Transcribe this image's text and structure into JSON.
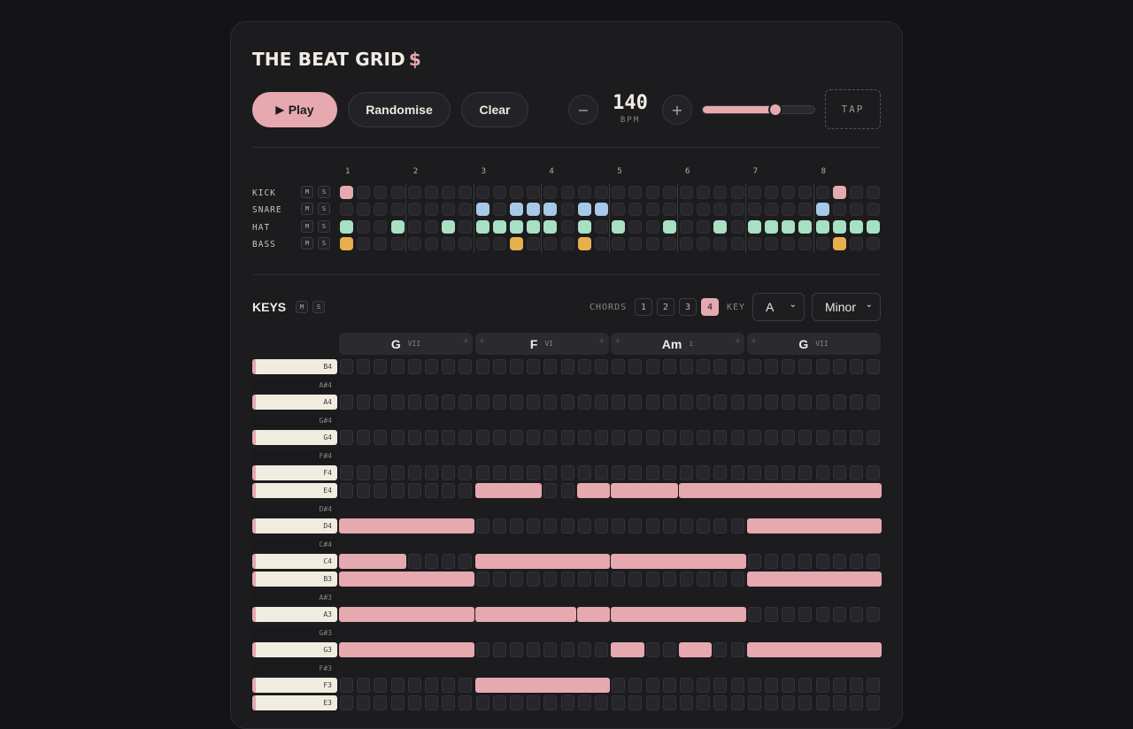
{
  "app": {
    "title": "THE BEAT GRID",
    "title_symbol": "$"
  },
  "transport": {
    "play_label": "Play",
    "play_icon": "play-triangle-icon",
    "randomise_label": "Randomise",
    "clear_label": "Clear",
    "decrement_label": "−",
    "increment_label": "+",
    "bpm_value": "140",
    "bpm_unit": "BPM",
    "tempo_slider_fraction": 0.66,
    "tap_label": "TAP"
  },
  "colors": {
    "accent": "#e6a9b0",
    "kick": "#e6a9b0",
    "snare": "#a8c8e8",
    "hat": "#a8e0c4",
    "bass": "#e8b04c"
  },
  "drums": {
    "bar_numbers": [
      "1",
      "2",
      "3",
      "4",
      "5",
      "6",
      "7",
      "8"
    ],
    "mute_label": "M",
    "solo_label": "S",
    "tracks": [
      {
        "name": "KICK",
        "color_key": "kick",
        "on": [
          0,
          29
        ]
      },
      {
        "name": "SNARE",
        "color_key": "snare",
        "on": [
          8,
          10,
          11,
          12,
          14,
          15,
          28
        ]
      },
      {
        "name": "HAT",
        "color_key": "hat",
        "on": [
          0,
          3,
          6,
          8,
          9,
          10,
          11,
          12,
          14,
          16,
          19,
          22,
          24,
          25,
          26,
          27,
          28,
          29,
          30,
          31
        ]
      },
      {
        "name": "BASS",
        "color_key": "bass",
        "on": [
          0,
          10,
          14,
          29
        ]
      }
    ]
  },
  "keys": {
    "title": "KEYS",
    "mute_label": "M",
    "solo_label": "S",
    "chords_label": "CHORDS",
    "chord_count_options": [
      "1",
      "2",
      "3",
      "4"
    ],
    "chord_count_selected": "4",
    "key_label": "KEY",
    "key_value": "A",
    "scale_value": "Minor",
    "chords": [
      {
        "name": "G",
        "roman": "VII"
      },
      {
        "name": "F",
        "roman": "VI"
      },
      {
        "name": "Am",
        "roman": "i"
      },
      {
        "name": "G",
        "roman": "VII"
      }
    ],
    "rows": [
      {
        "note": "B4",
        "black": false,
        "notes": []
      },
      {
        "note": "A#4",
        "black": true,
        "notes": []
      },
      {
        "note": "A4",
        "black": false,
        "notes": []
      },
      {
        "note": "G#4",
        "black": true,
        "notes": []
      },
      {
        "note": "G4",
        "black": false,
        "notes": []
      },
      {
        "note": "F#4",
        "black": true,
        "notes": []
      },
      {
        "note": "F4",
        "black": false,
        "notes": []
      },
      {
        "note": "E4",
        "black": false,
        "notes": [
          [
            8,
            4
          ],
          [
            14,
            2
          ],
          [
            16,
            4
          ],
          [
            20,
            12
          ]
        ]
      },
      {
        "note": "D#4",
        "black": true,
        "notes": []
      },
      {
        "note": "D4",
        "black": false,
        "notes": [
          [
            0,
            8
          ],
          [
            24,
            8
          ]
        ]
      },
      {
        "note": "C#4",
        "black": true,
        "notes": []
      },
      {
        "note": "C4",
        "black": false,
        "notes": [
          [
            0,
            4
          ],
          [
            8,
            8
          ],
          [
            16,
            8
          ]
        ]
      },
      {
        "note": "B3",
        "black": false,
        "notes": [
          [
            0,
            8
          ],
          [
            24,
            8
          ]
        ]
      },
      {
        "note": "A#3",
        "black": true,
        "notes": []
      },
      {
        "note": "A3",
        "black": false,
        "notes": [
          [
            0,
            8
          ],
          [
            8,
            6
          ],
          [
            14,
            2
          ],
          [
            16,
            8
          ]
        ]
      },
      {
        "note": "G#3",
        "black": true,
        "notes": []
      },
      {
        "note": "G3",
        "black": false,
        "notes": [
          [
            0,
            8
          ],
          [
            16,
            2
          ],
          [
            20,
            2
          ],
          [
            24,
            8
          ]
        ]
      },
      {
        "note": "F#3",
        "black": true,
        "notes": []
      },
      {
        "note": "F3",
        "black": false,
        "notes": [
          [
            8,
            8
          ]
        ]
      },
      {
        "note": "E3",
        "black": false,
        "notes": []
      }
    ]
  }
}
